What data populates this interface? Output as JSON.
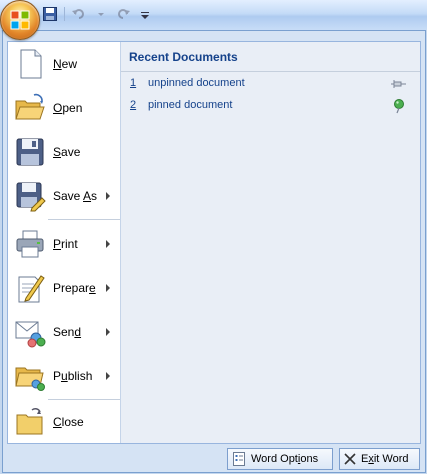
{
  "quick_access": {
    "save": "save-icon",
    "undo": "undo-icon",
    "redo": "redo-icon",
    "customize": "customize-qat-icon"
  },
  "menu": {
    "items": [
      {
        "pre": "",
        "key": "N",
        "post": "ew",
        "icon": "new-document-icon",
        "submenu": false
      },
      {
        "pre": "",
        "key": "O",
        "post": "pen",
        "icon": "open-folder-icon",
        "submenu": false
      },
      {
        "pre": "",
        "key": "S",
        "post": "ave",
        "icon": "save-disk-icon",
        "submenu": false
      },
      {
        "pre": "Save ",
        "key": "A",
        "post": "s",
        "icon": "save-as-icon",
        "submenu": true
      },
      {
        "pre": "",
        "key": "P",
        "post": "rint",
        "icon": "printer-icon",
        "submenu": true
      },
      {
        "pre": "Prepar",
        "key": "e",
        "post": "",
        "icon": "prepare-icon",
        "submenu": true
      },
      {
        "pre": "Sen",
        "key": "d",
        "post": "",
        "icon": "send-icon",
        "submenu": true
      },
      {
        "pre": "P",
        "key": "u",
        "post": "blish",
        "icon": "publish-icon",
        "submenu": true
      },
      {
        "pre": "",
        "key": "C",
        "post": "lose",
        "icon": "close-folder-icon",
        "submenu": false
      }
    ]
  },
  "recent": {
    "title": "Recent Documents",
    "documents": [
      {
        "num": "1",
        "name": "unpinned document",
        "pinned": false
      },
      {
        "num": "2",
        "name": "pinned document",
        "pinned": true
      }
    ]
  },
  "buttons": {
    "options_pre": "Word Opt",
    "options_key": "i",
    "options_post": "ons",
    "exit_pre": "E",
    "exit_key": "x",
    "exit_post": "it Word"
  }
}
